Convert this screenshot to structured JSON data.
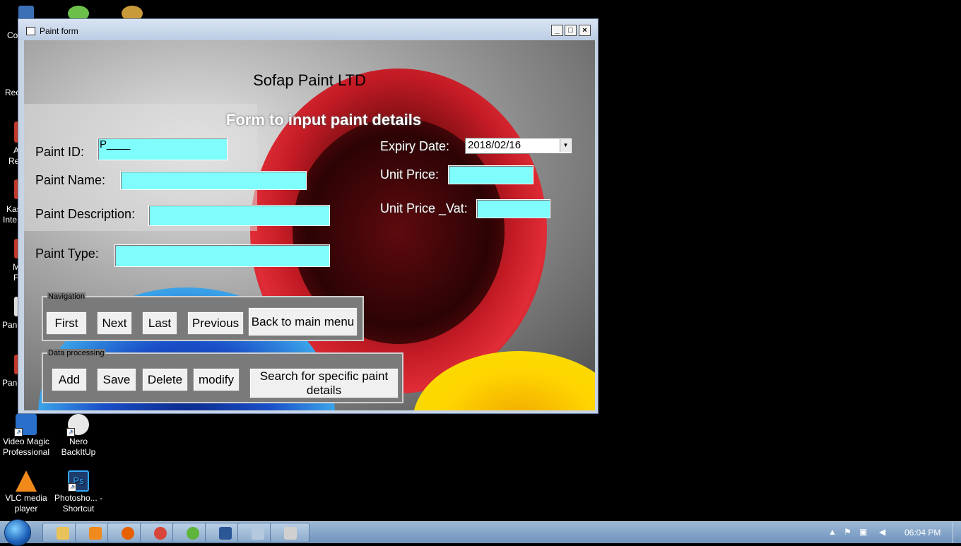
{
  "window": {
    "title": "Paint form",
    "minimize": "_",
    "maximize": "□",
    "close": "×"
  },
  "form": {
    "company": "Sofap Paint LTD",
    "subtitle": "Form to input paint details",
    "paint_id_label": "Paint ID:",
    "paint_id_value": "P____",
    "paint_name_label": "Paint Name:",
    "paint_name_value": "",
    "paint_description_label": "Paint Description:",
    "paint_description_value": "",
    "paint_type_label": "Paint Type:",
    "paint_type_value": "",
    "expiry_date_label": "Expiry Date:",
    "expiry_date_value": "2018/02/16",
    "unit_price_label": "Unit Price:",
    "unit_price_value": "",
    "unit_price_vat_label": "Unit Price _Vat:",
    "unit_price_vat_value": ""
  },
  "navigation": {
    "title": "Navigation",
    "first": "First",
    "next": "Next",
    "last": "Last",
    "previous": "Previous",
    "back": "Back to main menu"
  },
  "data_processing": {
    "title": "Data processing",
    "add": "Add",
    "save": "Save",
    "delete": "Delete",
    "modify": "modify",
    "search": "Search for specific paint details"
  },
  "desktop": {
    "partial_labels": [
      "Co",
      "Rec",
      "A",
      "Re",
      "Kas",
      "Inte",
      "M",
      "F",
      "Pane",
      "Pane"
    ],
    "icons": [
      {
        "label": "Video Magic Professional",
        "icon": "video-magic-icon",
        "color": "#2a6fc9"
      },
      {
        "label": "Nero BackItUp",
        "icon": "nero-icon",
        "color": "#e8e8e8"
      },
      {
        "label": "VLC media player",
        "icon": "vlc-icon",
        "color": "#f28a1b"
      },
      {
        "label": "Photosho... - Shortcut",
        "icon": "photoshop-icon",
        "color": "#1d3b6b"
      }
    ]
  },
  "taskbar": {
    "clock": "06:04 PM",
    "apps": [
      {
        "icon": "explorer-icon",
        "color": "#e9c35a"
      },
      {
        "icon": "media-player-icon",
        "color": "#f08a1c"
      },
      {
        "icon": "firefox-icon",
        "color": "#e66000"
      },
      {
        "icon": "chrome-icon",
        "color": "#d8453a"
      },
      {
        "icon": "utorrent-icon",
        "color": "#5fb43c"
      },
      {
        "icon": "word-icon",
        "color": "#2b5797"
      },
      {
        "icon": "vb-icon",
        "color": "#b5c9de"
      },
      {
        "icon": "app-icon",
        "color": "#d0d0d0"
      }
    ]
  }
}
